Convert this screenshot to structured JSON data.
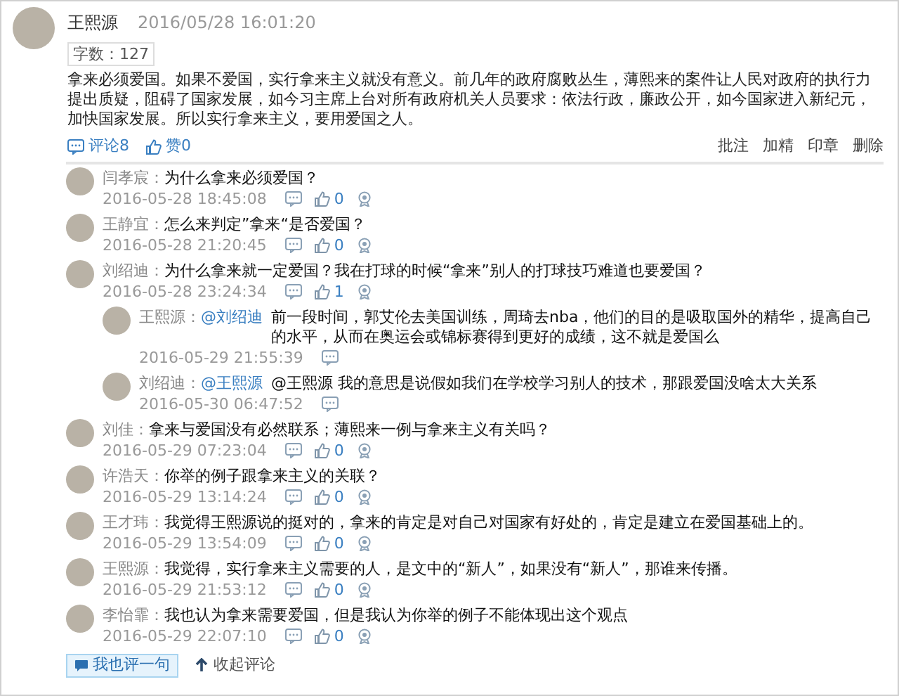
{
  "post": {
    "author": "王熙源",
    "time": "2016/05/28 16:01:20",
    "word_count": "字数：127",
    "body": "拿来必须爱国。如果不爱国，实行拿来主义就没有意义。前几年的政府腐败丛生，薄熙来的案件让人民对政府的执行力提出质疑，阻碍了国家发展，如今习主席上台对所有政府机关人员要求：依法行政，廉政公开，如今国家进入新纪元，加快国家发展。所以实行拿来主义，要用爱国之人。",
    "comments_label": "评论8",
    "likes_label": "赞0",
    "actions": [
      "批注",
      "加精",
      "印章",
      "删除"
    ]
  },
  "comments": [
    {
      "author": "闫孝宸：",
      "text": "为什么拿来必须爱国？",
      "time": "2016-05-28 18:45:08",
      "likes": "0"
    },
    {
      "author": "王静宜：",
      "text": "怎么来判定”拿来“是否爱国？",
      "time": "2016-05-28 21:20:45",
      "likes": "0"
    },
    {
      "author": "刘绍迪：",
      "text": "为什么拿来就一定爱国？我在打球的时候“拿来”别人的打球技巧难道也要爱国？",
      "time": "2016-05-28 23:24:34",
      "likes": "1",
      "replies": [
        {
          "author": "王熙源：",
          "reply_to": "@刘绍迪",
          "text": "前一段时间，郭艾伦去美国训练，周琦去nba，他们的目的是吸取国外的精华，提高自己的水平，从而在奥运会或锦标赛得到更好的成绩，这不就是爱国么",
          "time": "2016-05-29 21:55:39"
        },
        {
          "author": "刘绍迪：",
          "reply_to": "@王熙源",
          "text": "@王熙源 我的意思是说假如我们在学校学习别人的技术，那跟爱国没啥太大关系",
          "time": "2016-05-30 06:47:52"
        }
      ]
    },
    {
      "author": "刘佳：",
      "text": "拿来与爱国没有必然联系；薄熙来一例与拿来主义有关吗？",
      "time": "2016-05-29 07:23:04",
      "likes": "0"
    },
    {
      "author": "许浩天：",
      "text": "你举的例子跟拿来主义的关联？",
      "time": "2016-05-29 13:14:24",
      "likes": "0"
    },
    {
      "author": "王才玮：",
      "text": "我觉得王熙源说的挺对的，拿来的肯定是对自己对国家有好处的，肯定是建立在爱国基础上的。",
      "time": "2016-05-29 13:54:09",
      "likes": "0"
    },
    {
      "author": "王熙源：",
      "text": "我觉得，实行拿来主义需要的人，是文中的“新人”，如果没有“新人”，那谁来传播。",
      "time": "2016-05-29 21:53:12",
      "likes": "0"
    },
    {
      "author": "李怡霏：",
      "text": "我也认为拿来需要爱国，但是我认为你举的例子不能体现出这个观点",
      "time": "2016-05-29 22:07:10",
      "likes": "0"
    }
  ],
  "footer": {
    "comment_button": "我也评一句",
    "collapse_link": "收起评论"
  }
}
